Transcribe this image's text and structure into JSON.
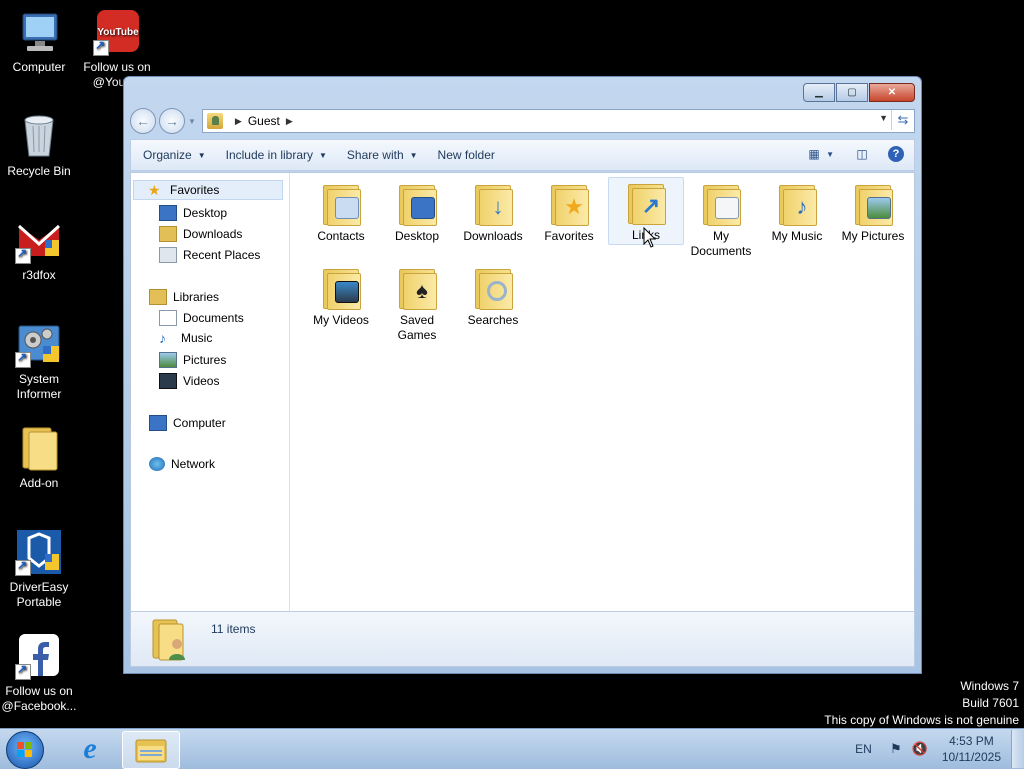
{
  "desktop": {
    "icons": [
      {
        "label": "Computer",
        "icon": "computer-icon"
      },
      {
        "label": "Follow us on @YouT...",
        "icon": "youtube-icon"
      },
      {
        "label": "Recycle Bin",
        "icon": "recycle-bin-icon"
      },
      {
        "label": "r3dfox",
        "icon": "r3dfox-icon"
      },
      {
        "label": "System Informer",
        "icon": "system-informer-icon"
      },
      {
        "label": "Add-on",
        "icon": "folder-icon"
      },
      {
        "label": "DriverEasy Portable",
        "icon": "drivereasy-icon"
      },
      {
        "label": "Follow us on @Facebook...",
        "icon": "facebook-icon"
      }
    ]
  },
  "window": {
    "address": {
      "crumbs": [
        "Guest"
      ]
    },
    "toolbar": {
      "organize": "Organize",
      "include": "Include in library",
      "share": "Share with",
      "new_folder": "New folder"
    },
    "nav": {
      "favorites": "Favorites",
      "desktop": "Desktop",
      "downloads": "Downloads",
      "recent": "Recent Places",
      "libraries": "Libraries",
      "documents": "Documents",
      "music": "Music",
      "pictures": "Pictures",
      "videos": "Videos",
      "computer": "Computer",
      "network": "Network"
    },
    "files": [
      {
        "label": "Contacts",
        "icon": "contacts-folder-icon"
      },
      {
        "label": "Desktop",
        "icon": "desktop-folder-icon"
      },
      {
        "label": "Downloads",
        "icon": "downloads-folder-icon"
      },
      {
        "label": "Favorites",
        "icon": "favorites-folder-icon"
      },
      {
        "label": "Links",
        "icon": "links-folder-icon"
      },
      {
        "label": "My Documents",
        "icon": "documents-folder-icon"
      },
      {
        "label": "My Music",
        "icon": "music-folder-icon"
      },
      {
        "label": "My Pictures",
        "icon": "pictures-folder-icon"
      },
      {
        "label": "My Videos",
        "icon": "videos-folder-icon"
      },
      {
        "label": "Saved Games",
        "icon": "saved-games-folder-icon"
      },
      {
        "label": "Searches",
        "icon": "searches-folder-icon"
      }
    ],
    "details": {
      "count": "11 items"
    }
  },
  "watermark": {
    "line1": "Windows 7",
    "line2": "Build 7601",
    "line3": "This copy of Windows is not genuine"
  },
  "taskbar": {
    "lang": "EN",
    "time": "4:53 PM",
    "date": "10/11/2025"
  },
  "colors": {
    "desktop_bg": "#000000",
    "window_frame": "#c3d7ef",
    "taskbar": "#b4cce8"
  }
}
